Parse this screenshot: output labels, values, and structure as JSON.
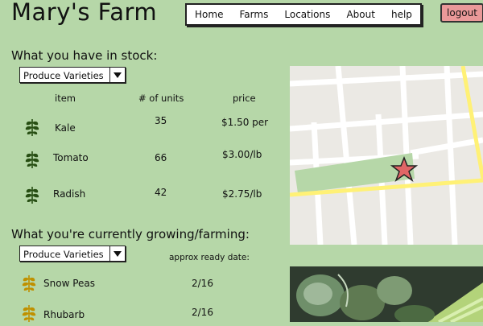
{
  "app": {
    "title": "Mary's Farm"
  },
  "nav": {
    "items": [
      "Home",
      "Farms",
      "Locations",
      "About",
      "help"
    ]
  },
  "auth": {
    "logout_label": "logout"
  },
  "stock": {
    "title": "What you have in stock:",
    "dropdown_label": "Produce Varieties",
    "headers": {
      "item": "item",
      "units": "# of units",
      "price": "price"
    },
    "rows": [
      {
        "item": "Kale",
        "units": "35",
        "price": "$1.50 per"
      },
      {
        "item": "Tomato",
        "units": "66",
        "price": "$3.00/lb"
      },
      {
        "item": "Radish",
        "units": "42",
        "price": "$2.75/lb"
      }
    ]
  },
  "growing": {
    "title": "What you're currently growing/farming:",
    "dropdown_label": "Produce Varieties",
    "ready_header": "approx ready date:",
    "rows": [
      {
        "item": "Snow Peas",
        "date": "2/16"
      },
      {
        "item": "Rhubarb",
        "date": "2/16"
      }
    ]
  },
  "colors": {
    "background": "#b6d7a8",
    "logout": "#ea9999",
    "stock_icon": "#274e13",
    "growing_icon": "#bf9000",
    "map_marker": "#e06666",
    "map_highlight_road": "#fff176"
  },
  "icons": {
    "stock_item": "leaf-icon",
    "growing_item": "sprout-icon",
    "map_marker": "star-marker-icon"
  }
}
